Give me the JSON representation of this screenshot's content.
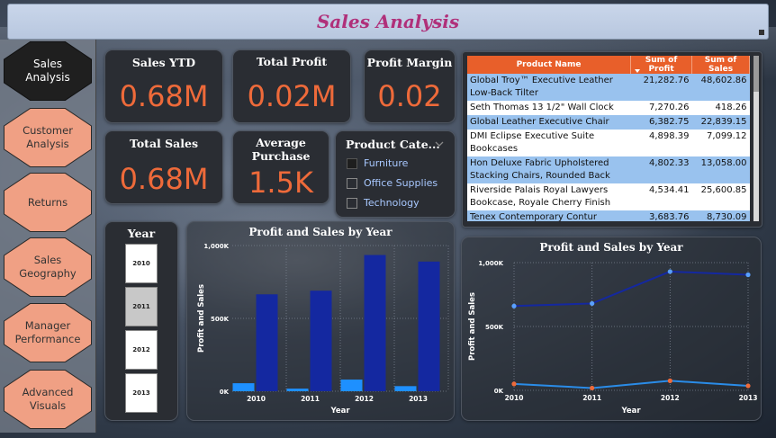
{
  "header": {
    "title": "Sales Analysis"
  },
  "nav": {
    "items": [
      {
        "label": "Sales Analysis",
        "active": true
      },
      {
        "label": "Customer Analysis",
        "active": false
      },
      {
        "label": "Returns",
        "active": false
      },
      {
        "label": "Sales Geography",
        "active": false
      },
      {
        "label": "Manager Performance",
        "active": false
      },
      {
        "label": "Advanced Visuals",
        "active": false
      }
    ]
  },
  "kpis": {
    "sales_ytd": {
      "label": "Sales YTD",
      "value": "0.68M"
    },
    "total_profit": {
      "label": "Total Profit",
      "value": "0.02M"
    },
    "profit_margin": {
      "label": "Profit Margin",
      "value": "0.02"
    },
    "total_sales": {
      "label": "Total Sales",
      "value": "0.68M"
    },
    "average_purchase": {
      "label": "Average Purchase",
      "value": "1.5K"
    }
  },
  "category_slicer": {
    "title": "Product Cate...",
    "options": [
      "Furniture",
      "Office Supplies",
      "Technology"
    ]
  },
  "year_slicer": {
    "title": "Year",
    "options": [
      "2010",
      "2011",
      "2012",
      "2013"
    ],
    "selected": "2011"
  },
  "product_table": {
    "columns": [
      "Product Name",
      "Sum of Profit",
      "Sum of Sales"
    ],
    "rows": [
      [
        "Global Troy™ Executive Leather Low-Back Tilter",
        "21,282.76",
        "48,602.86"
      ],
      [
        "Seth Thomas 13 1/2\" Wall Clock",
        "7,270.26",
        "418.26"
      ],
      [
        "Global Leather Executive Chair",
        "6,382.75",
        "22,839.15"
      ],
      [
        "DMI Eclipse Executive Suite Bookcases",
        "4,898.39",
        "7,099.12"
      ],
      [
        "Hon Deluxe Fabric Upholstered Stacking Chairs, Rounded Back",
        "4,802.33",
        "13,058.00"
      ],
      [
        "Riverside Palais Royal Lawyers Bookcase, Royale Cherry Finish",
        "4,534.41",
        "25,600.85"
      ],
      [
        "Tenex Contemporary Contur",
        "3,683.76",
        "8,730.09"
      ]
    ]
  },
  "colors": {
    "accent_orange": "#ee6a3a",
    "profit_blue": "#1e90ff",
    "sales_navy": "#1428a0",
    "title_magenta": "#b0307a"
  },
  "chart_data": [
    {
      "type": "bar",
      "title": "Profit and Sales by Year",
      "xlabel": "Year",
      "ylabel": "Profit and Sales",
      "categories": [
        "2010",
        "2011",
        "2012",
        "2013"
      ],
      "ylim": [
        0,
        1000000
      ],
      "yticks": [
        "0K",
        "500K",
        "1,000K"
      ],
      "series": [
        {
          "name": "Profit",
          "values": [
            55000,
            18000,
            80000,
            35000
          ],
          "color": "#1e90ff"
        },
        {
          "name": "Sales",
          "values": [
            665000,
            690000,
            935000,
            890000
          ],
          "color": "#1428a0"
        }
      ]
    },
    {
      "type": "line",
      "title": "Profit and Sales by Year",
      "xlabel": "Year",
      "ylabel": "Profit and Sales",
      "categories": [
        "2010",
        "2011",
        "2012",
        "2013"
      ],
      "ylim": [
        0,
        1000000
      ],
      "yticks": [
        "0K",
        "500K",
        "1,000K"
      ],
      "series": [
        {
          "name": "Profit",
          "values": [
            50000,
            18000,
            75000,
            35000
          ],
          "color": "#ee6a3a",
          "line_color": "#2a8ce8"
        },
        {
          "name": "Sales",
          "values": [
            660000,
            680000,
            930000,
            905000
          ],
          "color": "#5aa0ff",
          "line_color": "#1428a0"
        }
      ]
    }
  ]
}
